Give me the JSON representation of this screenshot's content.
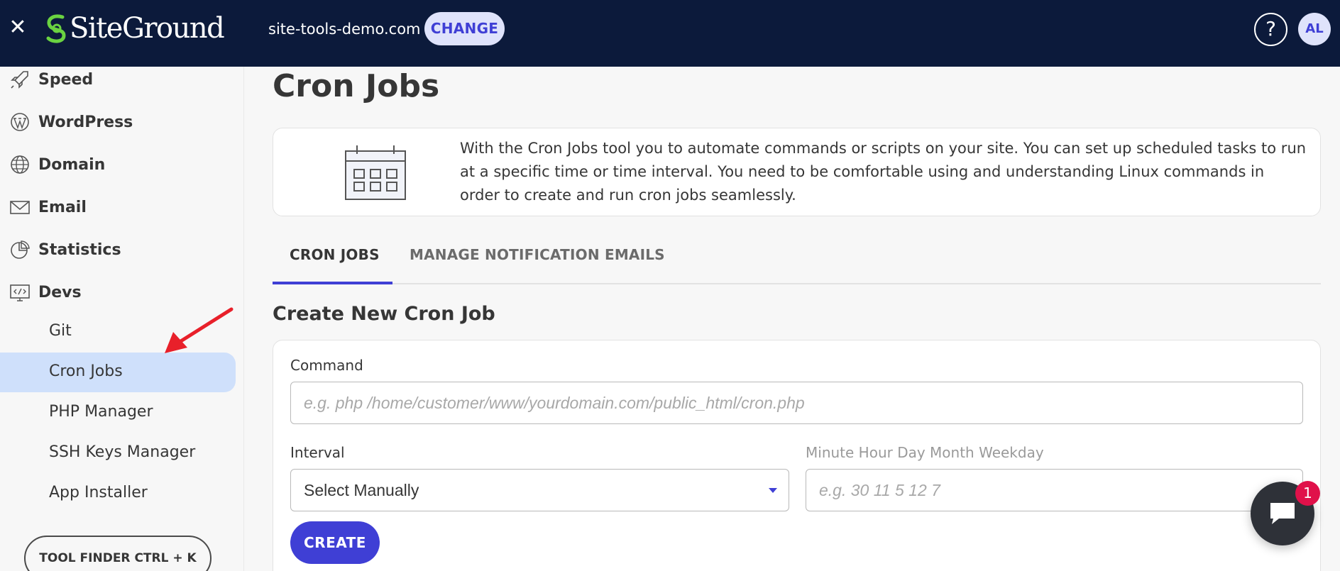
{
  "header": {
    "logo_text": "SiteGround",
    "site_name": "site-tools-demo.com",
    "change_label": "CHANGE",
    "help_label": "?",
    "avatar_initials": "AL"
  },
  "sidebar": {
    "items": [
      {
        "label": "Speed",
        "icon": "rocket-icon"
      },
      {
        "label": "WordPress",
        "icon": "wordpress-icon"
      },
      {
        "label": "Domain",
        "icon": "globe-icon"
      },
      {
        "label": "Email",
        "icon": "envelope-icon"
      },
      {
        "label": "Statistics",
        "icon": "pie-chart-icon"
      },
      {
        "label": "Devs",
        "icon": "code-monitor-icon"
      }
    ],
    "sub_items": [
      {
        "label": "Git"
      },
      {
        "label": "Cron Jobs"
      },
      {
        "label": "PHP Manager"
      },
      {
        "label": "SSH Keys Manager"
      },
      {
        "label": "App Installer"
      }
    ],
    "tool_finder_label": "TOOL FINDER CTRL + K"
  },
  "main": {
    "title": "Cron Jobs",
    "info_text": "With the Cron Jobs tool you to automate commands or scripts on your site. You can set up scheduled tasks to run at a specific time or time interval. You need to be comfortable using and understanding Linux commands in order to create and run cron jobs seamlessly.",
    "tabs": [
      {
        "label": "CRON JOBS"
      },
      {
        "label": "MANAGE NOTIFICATION EMAILS"
      }
    ],
    "section_title": "Create New Cron Job",
    "form": {
      "command_label": "Command",
      "command_placeholder": "e.g. php /home/customer/www/yourdomain.com/public_html/cron.php",
      "interval_label": "Interval",
      "interval_value": "Select Manually",
      "schedule_label": "Minute Hour Day Month Weekday",
      "schedule_placeholder": "e.g. 30 11 5 12 7",
      "create_label": "CREATE"
    }
  },
  "chat": {
    "badge_count": "1"
  },
  "colors": {
    "topbar": "#0c1a3b",
    "accent": "#3f3fd5",
    "active_bg": "#cfe0fb",
    "badge": "#e0114a",
    "arrow": "#e8202a"
  }
}
